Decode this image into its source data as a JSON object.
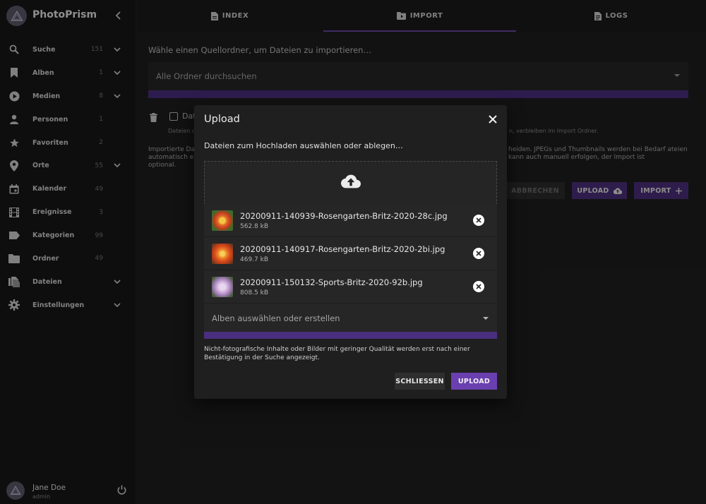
{
  "app": {
    "name": "PhotoPrism"
  },
  "sidebar": {
    "items": [
      {
        "label": "Suche",
        "count": "151",
        "icon": "search-icon",
        "expandable": true
      },
      {
        "label": "Alben",
        "count": "1",
        "icon": "bookmark-icon",
        "expandable": true
      },
      {
        "label": "Medien",
        "count": "8",
        "icon": "play-circle-icon",
        "expandable": true
      },
      {
        "label": "Personen",
        "count": "1",
        "icon": "person-icon",
        "expandable": false
      },
      {
        "label": "Favoriten",
        "count": "2",
        "icon": "star-icon",
        "expandable": false
      },
      {
        "label": "Orte",
        "count": "55",
        "icon": "map-pin-icon",
        "expandable": true
      },
      {
        "label": "Kalender",
        "count": "49",
        "icon": "calendar-icon",
        "expandable": false
      },
      {
        "label": "Ereignisse",
        "count": "3",
        "icon": "film-icon",
        "expandable": false
      },
      {
        "label": "Kategorien",
        "count": "99",
        "icon": "label-icon",
        "expandable": false
      },
      {
        "label": "Ordner",
        "count": "49",
        "icon": "folder-icon",
        "expandable": false
      },
      {
        "label": "Dateien",
        "count": "",
        "icon": "files-icon",
        "expandable": true
      },
      {
        "label": "Einstellungen",
        "count": "",
        "icon": "gear-icon",
        "expandable": true
      }
    ],
    "user": {
      "name": "Jane Doe",
      "role": "admin"
    }
  },
  "tabs": [
    {
      "label": "INDEX",
      "icon": "file-icon"
    },
    {
      "label": "IMPORT",
      "icon": "folder-import-icon"
    },
    {
      "label": "LOGS",
      "icon": "log-file-icon"
    }
  ],
  "import": {
    "hint": "Wähle einen Quellordner, um Dateien zu importieren…",
    "folder_select": "Alle Ordner durchsuchen",
    "checkbox_label": "Dat",
    "small_left": "Dateien o",
    "small_right": "n, verbleiben im Import Ordner.",
    "desc_left": "Importierte Da automatisch er optional.",
    "desc_right": "heiden. JPEGs und Thumbnails werden bei Bedarf ateien kann auch manuell erfolgen, der Import ist",
    "cancel": "ABBRECHEN",
    "upload": "UPLOAD",
    "import": "IMPORT"
  },
  "dialog": {
    "title": "Upload",
    "subtitle": "Dateien zum Hochladen auswählen oder ablegen…",
    "files": [
      {
        "name": "20200911-140939-Rosengarten-Britz-2020-28c.jpg",
        "size": "562.8 kB"
      },
      {
        "name": "20200911-140917-Rosengarten-Britz-2020-2bi.jpg",
        "size": "469.7 kB"
      },
      {
        "name": "20200911-150132-Sports-Britz-2020-92b.jpg",
        "size": "808.5 kB"
      }
    ],
    "album_placeholder": "Alben auswählen oder erstellen",
    "note": "Nicht-fotografische Inhalte oder Bilder mit geringer Qualität werden erst nach einer Bestätigung in der Suche angezeigt.",
    "close_label": "SCHLIESSEN",
    "upload_label": "UPLOAD"
  },
  "colors": {
    "accent": "#6a3fb0",
    "accent_dark": "#4b2f7b",
    "background": "#1e1e1e"
  }
}
